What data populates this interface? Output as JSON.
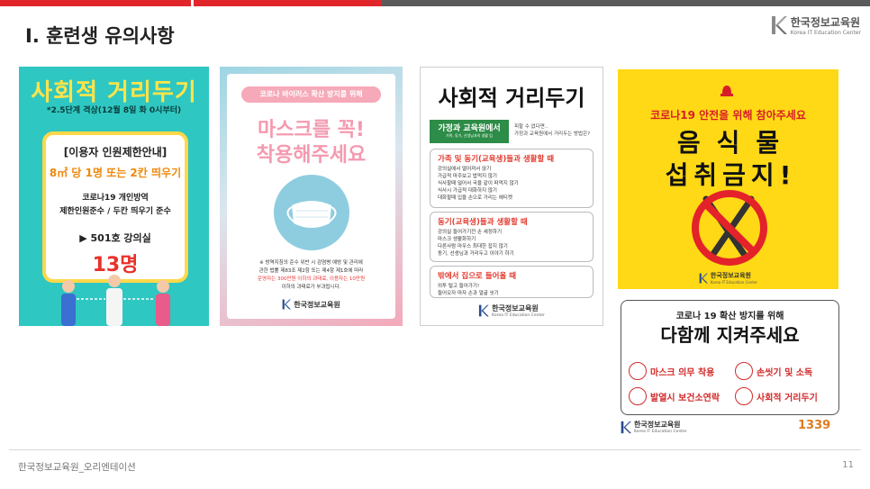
{
  "header": {
    "title": "Ⅰ. 훈련생 유의사항",
    "logo_kr": "한국정보교육원",
    "logo_en": "Korea IT Education Center"
  },
  "poster1": {
    "title": "사회적 거리두기",
    "subtitle": "*2.5단계 격상(12월 8일 화 0시부터)",
    "line1": "[이용자 인원제한안내]",
    "line2": "8㎡ 당 1명 또는 2칸 띄우기",
    "line3": "코로나19 개인방역",
    "line4": "제한인원준수 / 두칸 띄우기 준수",
    "line5": "▶ 501호 강의실",
    "line6": "13명"
  },
  "poster2": {
    "pill": "코로나 바이러스 확산 방지를 위해",
    "big1": "마스크를 꼭!",
    "big2": "착용해주세요",
    "fine1": "※ 방역지침의 준수 위반 시 감염병 예방 및 관리에",
    "fine2": "관한 법률 제83조 제2항 또는 제4항 제1호에 따라",
    "fine3": "운영자는 300만원 이하의 과태료, 이용자는 10만원",
    "fine4": "이하의 과태료가 부과됩니다.",
    "org": "한국정보교육원"
  },
  "poster3": {
    "title": "사회적 거리두기",
    "green_a": "가정과 교육원에서",
    "green_b": "가족, 동기, 선생님과의 생활 팁",
    "side1": "피할 수 없다면..",
    "side2": "가정과 교육원에서 거리두는 방법은?",
    "box1_head": "가족 및 동기(교육생)들과 생활할 때",
    "box1_items": [
      "강의실에서 떨어져서 앉기",
      "가급적 마주보고 밥먹지 않기",
      "식사할때 덜어서 국을 같이 떠먹지 않기",
      "식사시 가급적 대화하지 않기",
      "대화할때 입을 손으로 가리는 에티켓"
    ],
    "box2_head": "동기(교육생)들과 생활할 때",
    "box2_items": [
      "강의실 들어가기전 손 세정하기",
      "마스크 생활화하기",
      "다른사람 마우스 최대한 잡지 않기",
      "동기, 선생님과 거리두고 이야기 하기"
    ],
    "box3_head": "밖에서 집으로 들어올 때",
    "box3_items": [
      "외투 털고 들어가기!",
      "들어오자 마자 손과 얼굴 씻기"
    ],
    "org_kr": "한국정보교육원",
    "org_en": "Korea IT Education Center"
  },
  "poster4": {
    "head": "코로나19 안전을 위해 참아주세요",
    "big1": "음식물",
    "big2": "섭취금지!",
    "org_kr": "한국정보교육원",
    "org_en": "Korea IT Education Center"
  },
  "poster5": {
    "head1": "코로나 19 확산 방지를 위해",
    "head2": "다함께 지켜주세요",
    "items": [
      "마스크 의무 착용",
      "손씻기 및 소독",
      "발열시 보건소연락",
      "사회적 거리두기"
    ],
    "org_kr": "한국정보교육원",
    "org_en": "Korea IT Education Center",
    "hotline": "1339"
  },
  "footer": {
    "text": "한국정보교육원_오리엔테이션",
    "page": "11"
  }
}
